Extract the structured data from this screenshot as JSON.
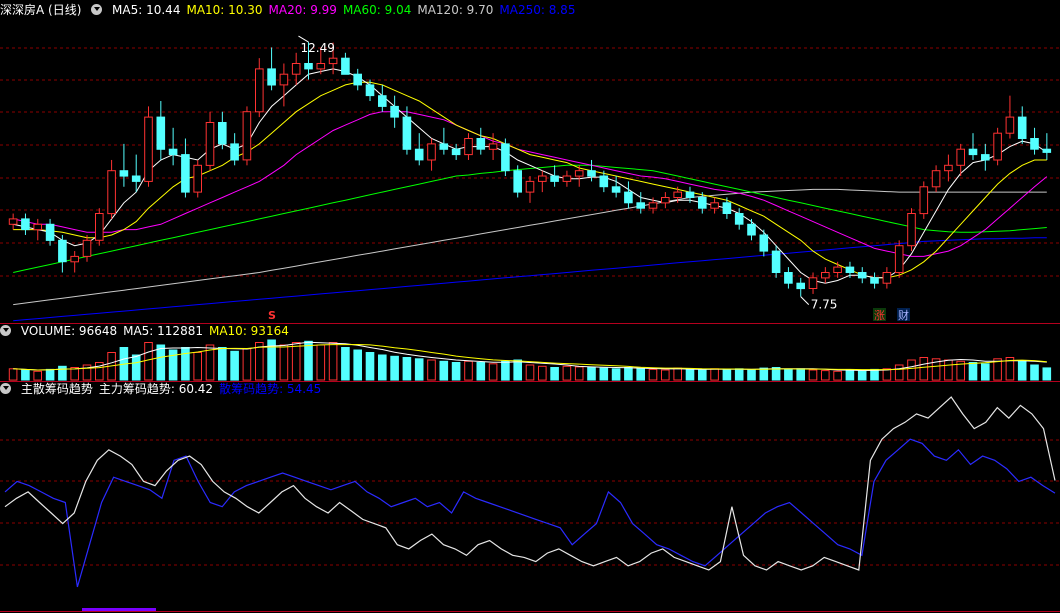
{
  "price_panel": {
    "title": "深深房A (日线)",
    "ma": [
      {
        "label": "MA5: 10.44",
        "color": "#ffffff"
      },
      {
        "label": "MA10: 10.30",
        "color": "#ffff00"
      },
      {
        "label": "MA20: 9.99",
        "color": "#ff00ff"
      },
      {
        "label": "MA60: 9.04",
        "color": "#00ff00"
      },
      {
        "label": "MA120: 9.70",
        "color": "#c8c8c8"
      },
      {
        "label": "MA250: 8.85",
        "color": "#0000ff"
      }
    ],
    "high_label": "12.49",
    "low_label": "7.75",
    "markers": {
      "s": "S",
      "zhang": "涨",
      "cai": "财"
    }
  },
  "volume_panel": {
    "items": [
      {
        "label": "VOLUME: 96648",
        "color": "#ffffff"
      },
      {
        "label": "MA5: 112881",
        "color": "#ffffff"
      },
      {
        "label": "MA10: 93164",
        "color": "#ffff00"
      }
    ]
  },
  "indicator_panel": {
    "items": [
      {
        "label": "主散筹码趋势",
        "color": "#ffffff"
      },
      {
        "label": "主力筹码趋势: 60.42",
        "color": "#ffffff"
      },
      {
        "label": "散筹码趋势: 54.45",
        "color": "#0000ff"
      }
    ]
  },
  "colors": {
    "up": "#ff3232",
    "down": "#54ffff",
    "grid": "#8b0000",
    "axis": "#b4001e"
  },
  "chart_data": {
    "type": "candlestick",
    "y_axis_price": [
      7.5,
      12.8
    ],
    "candles": [
      [
        9.1,
        9.3,
        9.0,
        9.2
      ],
      [
        9.2,
        9.3,
        8.9,
        9.0
      ],
      [
        9.0,
        9.2,
        8.8,
        9.1
      ],
      [
        9.1,
        9.2,
        8.7,
        8.8
      ],
      [
        8.8,
        8.9,
        8.2,
        8.4
      ],
      [
        8.4,
        8.6,
        8.2,
        8.5
      ],
      [
        8.5,
        8.9,
        8.4,
        8.8
      ],
      [
        8.8,
        9.4,
        8.7,
        9.3
      ],
      [
        9.3,
        10.3,
        9.2,
        10.1
      ],
      [
        10.1,
        10.6,
        9.8,
        10.0
      ],
      [
        10.0,
        10.4,
        9.7,
        9.9
      ],
      [
        9.9,
        11.3,
        9.8,
        11.1
      ],
      [
        11.1,
        11.4,
        10.3,
        10.5
      ],
      [
        10.5,
        10.9,
        10.2,
        10.4
      ],
      [
        10.4,
        10.7,
        9.6,
        9.7
      ],
      [
        9.7,
        10.3,
        9.6,
        10.2
      ],
      [
        10.2,
        11.2,
        10.1,
        11.0
      ],
      [
        11.0,
        11.2,
        10.5,
        10.6
      ],
      [
        10.6,
        10.8,
        10.2,
        10.3
      ],
      [
        10.3,
        11.3,
        10.2,
        11.2
      ],
      [
        11.2,
        12.2,
        11.1,
        12.0
      ],
      [
        12.0,
        12.4,
        11.6,
        11.7
      ],
      [
        11.7,
        12.1,
        11.3,
        11.9
      ],
      [
        11.9,
        12.3,
        11.7,
        12.1
      ],
      [
        12.1,
        12.5,
        11.8,
        12.0
      ],
      [
        12.0,
        12.4,
        11.9,
        12.1
      ],
      [
        12.1,
        12.49,
        11.9,
        12.2
      ],
      [
        12.2,
        12.3,
        11.9,
        11.9
      ],
      [
        11.9,
        12.0,
        11.6,
        11.7
      ],
      [
        11.7,
        11.8,
        11.4,
        11.5
      ],
      [
        11.5,
        11.7,
        11.2,
        11.3
      ],
      [
        11.3,
        11.5,
        10.9,
        11.1
      ],
      [
        11.1,
        11.3,
        10.4,
        10.5
      ],
      [
        10.5,
        10.8,
        10.2,
        10.3
      ],
      [
        10.3,
        10.7,
        10.1,
        10.6
      ],
      [
        10.6,
        10.9,
        10.4,
        10.5
      ],
      [
        10.5,
        10.6,
        10.3,
        10.4
      ],
      [
        10.4,
        10.8,
        10.3,
        10.7
      ],
      [
        10.7,
        10.9,
        10.4,
        10.5
      ],
      [
        10.5,
        10.8,
        10.3,
        10.6
      ],
      [
        10.6,
        10.7,
        10.0,
        10.1
      ],
      [
        10.1,
        10.2,
        9.6,
        9.7
      ],
      [
        9.7,
        10.0,
        9.5,
        9.9
      ],
      [
        9.9,
        10.1,
        9.7,
        10.0
      ],
      [
        10.0,
        10.2,
        9.8,
        9.9
      ],
      [
        9.9,
        10.1,
        9.8,
        10.0
      ],
      [
        10.0,
        10.2,
        9.8,
        10.1
      ],
      [
        10.1,
        10.3,
        9.9,
        10.0
      ],
      [
        10.0,
        10.1,
        9.7,
        9.8
      ],
      [
        9.8,
        10.0,
        9.6,
        9.7
      ],
      [
        9.7,
        9.9,
        9.4,
        9.5
      ],
      [
        9.5,
        9.7,
        9.3,
        9.4
      ],
      [
        9.4,
        9.6,
        9.3,
        9.5
      ],
      [
        9.5,
        9.7,
        9.4,
        9.6
      ],
      [
        9.6,
        9.8,
        9.5,
        9.7
      ],
      [
        9.7,
        9.8,
        9.5,
        9.6
      ],
      [
        9.6,
        9.7,
        9.3,
        9.4
      ],
      [
        9.4,
        9.6,
        9.3,
        9.5
      ],
      [
        9.5,
        9.6,
        9.2,
        9.3
      ],
      [
        9.3,
        9.4,
        9.0,
        9.1
      ],
      [
        9.1,
        9.2,
        8.8,
        8.9
      ],
      [
        8.9,
        9.0,
        8.5,
        8.6
      ],
      [
        8.6,
        8.7,
        8.1,
        8.2
      ],
      [
        8.2,
        8.3,
        7.9,
        8.0
      ],
      [
        8.0,
        8.1,
        7.75,
        7.9
      ],
      [
        7.9,
        8.2,
        7.8,
        8.1
      ],
      [
        8.1,
        8.3,
        8.0,
        8.2
      ],
      [
        8.2,
        8.4,
        8.1,
        8.3
      ],
      [
        8.3,
        8.4,
        8.1,
        8.2
      ],
      [
        8.2,
        8.3,
        8.0,
        8.1
      ],
      [
        8.1,
        8.2,
        7.9,
        8.0
      ],
      [
        8.0,
        8.3,
        7.9,
        8.2
      ],
      [
        8.2,
        8.8,
        8.1,
        8.7
      ],
      [
        8.7,
        9.4,
        8.6,
        9.3
      ],
      [
        9.3,
        9.9,
        9.2,
        9.8
      ],
      [
        9.8,
        10.2,
        9.7,
        10.1
      ],
      [
        10.1,
        10.4,
        9.9,
        10.2
      ],
      [
        10.2,
        10.6,
        10.0,
        10.5
      ],
      [
        10.5,
        10.8,
        10.3,
        10.4
      ],
      [
        10.4,
        10.6,
        10.1,
        10.3
      ],
      [
        10.3,
        10.9,
        10.2,
        10.8
      ],
      [
        10.8,
        11.5,
        10.7,
        11.1
      ],
      [
        11.1,
        11.3,
        10.6,
        10.7
      ],
      [
        10.7,
        10.9,
        10.4,
        10.5
      ],
      [
        10.5,
        10.8,
        10.3,
        10.44
      ]
    ],
    "ma5": [
      9.1,
      9.05,
      9.0,
      8.95,
      8.8,
      8.7,
      8.75,
      8.9,
      9.2,
      9.5,
      9.7,
      10.1,
      10.3,
      10.4,
      10.35,
      10.3,
      10.5,
      10.6,
      10.5,
      10.6,
      11.0,
      11.3,
      11.5,
      11.7,
      11.9,
      11.95,
      12.0,
      11.95,
      11.85,
      11.7,
      11.5,
      11.3,
      11.1,
      10.9,
      10.7,
      10.6,
      10.5,
      10.55,
      10.55,
      10.55,
      10.45,
      10.3,
      10.2,
      10.1,
      10.0,
      9.95,
      9.95,
      9.98,
      9.98,
      9.9,
      9.75,
      9.6,
      9.55,
      9.5,
      9.55,
      9.55,
      9.5,
      9.45,
      9.4,
      9.3,
      9.15,
      8.95,
      8.7,
      8.45,
      8.2,
      8.05,
      8.0,
      8.05,
      8.15,
      8.15,
      8.1,
      8.1,
      8.25,
      8.55,
      8.95,
      9.35,
      9.75,
      10.05,
      10.25,
      10.3,
      10.4,
      10.55,
      10.65,
      10.6,
      10.44
    ],
    "ma10": [
      9.0,
      9.0,
      9.0,
      8.98,
      8.95,
      8.9,
      8.85,
      8.85,
      8.9,
      9.0,
      9.15,
      9.4,
      9.6,
      9.8,
      9.95,
      10.0,
      10.1,
      10.2,
      10.35,
      10.45,
      10.6,
      10.8,
      11.0,
      11.2,
      11.35,
      11.5,
      11.6,
      11.7,
      11.75,
      11.75,
      11.7,
      11.6,
      11.5,
      11.4,
      11.25,
      11.1,
      10.95,
      10.85,
      10.75,
      10.7,
      10.6,
      10.5,
      10.4,
      10.35,
      10.3,
      10.25,
      10.15,
      10.1,
      10.05,
      10.0,
      9.95,
      9.9,
      9.85,
      9.8,
      9.75,
      9.7,
      9.65,
      9.6,
      9.55,
      9.45,
      9.35,
      9.25,
      9.1,
      8.95,
      8.8,
      8.6,
      8.45,
      8.35,
      8.25,
      8.15,
      8.1,
      8.1,
      8.15,
      8.25,
      8.4,
      8.6,
      8.85,
      9.1,
      9.35,
      9.6,
      9.85,
      10.05,
      10.2,
      10.3,
      10.3
    ],
    "ma20": [
      9.2,
      9.15,
      9.1,
      9.1,
      9.05,
      9.0,
      8.95,
      8.95,
      8.95,
      9.0,
      9.0,
      9.05,
      9.1,
      9.2,
      9.3,
      9.4,
      9.5,
      9.6,
      9.7,
      9.8,
      9.9,
      10.05,
      10.2,
      10.4,
      10.55,
      10.7,
      10.85,
      10.95,
      11.05,
      11.15,
      11.2,
      11.2,
      11.2,
      11.15,
      11.1,
      11.05,
      10.95,
      10.85,
      10.75,
      10.65,
      10.6,
      10.5,
      10.45,
      10.4,
      10.35,
      10.3,
      10.25,
      10.2,
      10.15,
      10.1,
      10.05,
      10.0,
      9.98,
      9.95,
      9.9,
      9.85,
      9.8,
      9.75,
      9.72,
      9.68,
      9.62,
      9.55,
      9.45,
      9.35,
      9.25,
      9.15,
      9.05,
      8.95,
      8.85,
      8.75,
      8.65,
      8.6,
      8.55,
      8.5,
      8.5,
      8.55,
      8.6,
      8.7,
      8.85,
      9.0,
      9.2,
      9.4,
      9.6,
      9.8,
      9.99
    ],
    "ma60": [
      8.2,
      8.25,
      8.3,
      8.35,
      8.4,
      8.45,
      8.5,
      8.55,
      8.6,
      8.65,
      8.7,
      8.75,
      8.8,
      8.85,
      8.9,
      8.95,
      9.0,
      9.05,
      9.1,
      9.15,
      9.2,
      9.25,
      9.3,
      9.35,
      9.4,
      9.45,
      9.5,
      9.55,
      9.6,
      9.65,
      9.7,
      9.75,
      9.8,
      9.85,
      9.9,
      9.95,
      10.0,
      10.02,
      10.05,
      10.07,
      10.1,
      10.12,
      10.14,
      10.16,
      10.18,
      10.2,
      10.2,
      10.2,
      10.18,
      10.16,
      10.14,
      10.12,
      10.1,
      10.05,
      10.0,
      9.95,
      9.9,
      9.85,
      9.8,
      9.75,
      9.7,
      9.65,
      9.6,
      9.55,
      9.5,
      9.45,
      9.4,
      9.35,
      9.3,
      9.25,
      9.2,
      9.15,
      9.1,
      9.05,
      9.0,
      8.98,
      8.96,
      8.95,
      8.95,
      8.96,
      8.97,
      8.98,
      9.0,
      9.02,
      9.04
    ],
    "ma120": [
      7.6,
      7.63,
      7.66,
      7.69,
      7.72,
      7.75,
      7.78,
      7.81,
      7.84,
      7.87,
      7.9,
      7.93,
      7.96,
      7.99,
      8.02,
      8.05,
      8.08,
      8.11,
      8.14,
      8.17,
      8.2,
      8.24,
      8.28,
      8.32,
      8.36,
      8.4,
      8.44,
      8.48,
      8.52,
      8.56,
      8.6,
      8.64,
      8.68,
      8.72,
      8.76,
      8.8,
      8.84,
      8.88,
      8.92,
      8.96,
      9.0,
      9.04,
      9.08,
      9.12,
      9.16,
      9.2,
      9.24,
      9.28,
      9.32,
      9.36,
      9.4,
      9.44,
      9.48,
      9.52,
      9.56,
      9.6,
      9.62,
      9.64,
      9.66,
      9.68,
      9.7,
      9.71,
      9.72,
      9.73,
      9.74,
      9.75,
      9.75,
      9.75,
      9.74,
      9.73,
      9.72,
      9.71,
      9.7,
      9.7,
      9.7,
      9.7,
      9.7,
      9.7,
      9.7,
      9.7,
      9.7,
      9.7,
      9.7,
      9.7,
      9.7
    ],
    "ma250": [
      7.3,
      7.32,
      7.34,
      7.36,
      7.38,
      7.4,
      7.42,
      7.44,
      7.46,
      7.48,
      7.5,
      7.52,
      7.54,
      7.56,
      7.58,
      7.6,
      7.62,
      7.64,
      7.66,
      7.68,
      7.7,
      7.72,
      7.74,
      7.76,
      7.78,
      7.8,
      7.82,
      7.84,
      7.86,
      7.88,
      7.9,
      7.92,
      7.94,
      7.96,
      7.98,
      8.0,
      8.02,
      8.04,
      8.06,
      8.08,
      8.1,
      8.12,
      8.14,
      8.16,
      8.18,
      8.2,
      8.22,
      8.24,
      8.26,
      8.28,
      8.3,
      8.32,
      8.34,
      8.36,
      8.38,
      8.4,
      8.42,
      8.44,
      8.46,
      8.48,
      8.5,
      8.52,
      8.54,
      8.56,
      8.58,
      8.6,
      8.62,
      8.64,
      8.66,
      8.68,
      8.7,
      8.72,
      8.74,
      8.76,
      8.78,
      8.79,
      8.8,
      8.81,
      8.82,
      8.83,
      8.83,
      8.84,
      8.84,
      8.85,
      8.85
    ],
    "volume": [
      90,
      80,
      70,
      85,
      110,
      100,
      120,
      140,
      220,
      260,
      200,
      300,
      280,
      240,
      260,
      220,
      280,
      260,
      230,
      250,
      300,
      320,
      280,
      300,
      310,
      280,
      300,
      260,
      240,
      220,
      200,
      190,
      180,
      170,
      160,
      150,
      140,
      150,
      140,
      130,
      150,
      160,
      120,
      110,
      100,
      110,
      105,
      100,
      95,
      90,
      100,
      90,
      85,
      80,
      95,
      85,
      80,
      90,
      85,
      90,
      80,
      95,
      100,
      85,
      90,
      80,
      75,
      70,
      80,
      75,
      85,
      90,
      120,
      160,
      180,
      170,
      160,
      150,
      140,
      130,
      170,
      180,
      150,
      120,
      96.6
    ],
    "main_trend": [
      48,
      52,
      55,
      50,
      45,
      40,
      45,
      60,
      70,
      75,
      72,
      68,
      60,
      58,
      65,
      70,
      72,
      68,
      60,
      55,
      52,
      48,
      45,
      50,
      55,
      58,
      52,
      48,
      45,
      50,
      46,
      42,
      40,
      38,
      30,
      28,
      32,
      35,
      30,
      28,
      25,
      30,
      32,
      28,
      25,
      24,
      22,
      26,
      28,
      25,
      22,
      20,
      22,
      24,
      20,
      22,
      26,
      28,
      24,
      22,
      20,
      18,
      22,
      48,
      25,
      20,
      18,
      22,
      20,
      18,
      20,
      24,
      22,
      20,
      18,
      70,
      80,
      85,
      88,
      92,
      90,
      95,
      100,
      92,
      85,
      88,
      95,
      90,
      96,
      92,
      85,
      60.42
    ],
    "retail_trend": [
      55,
      60,
      58,
      55,
      52,
      50,
      10,
      30,
      50,
      62,
      60,
      58,
      56,
      52,
      70,
      72,
      60,
      50,
      48,
      55,
      58,
      60,
      62,
      64,
      62,
      60,
      58,
      56,
      58,
      60,
      55,
      52,
      48,
      50,
      52,
      48,
      50,
      45,
      55,
      52,
      50,
      48,
      46,
      44,
      42,
      40,
      38,
      30,
      35,
      40,
      55,
      50,
      40,
      35,
      30,
      28,
      25,
      22,
      20,
      25,
      30,
      35,
      40,
      45,
      48,
      50,
      45,
      40,
      35,
      30,
      28,
      25,
      60,
      70,
      75,
      80,
      78,
      72,
      70,
      75,
      68,
      72,
      70,
      66,
      60,
      62,
      58,
      54.45
    ]
  }
}
